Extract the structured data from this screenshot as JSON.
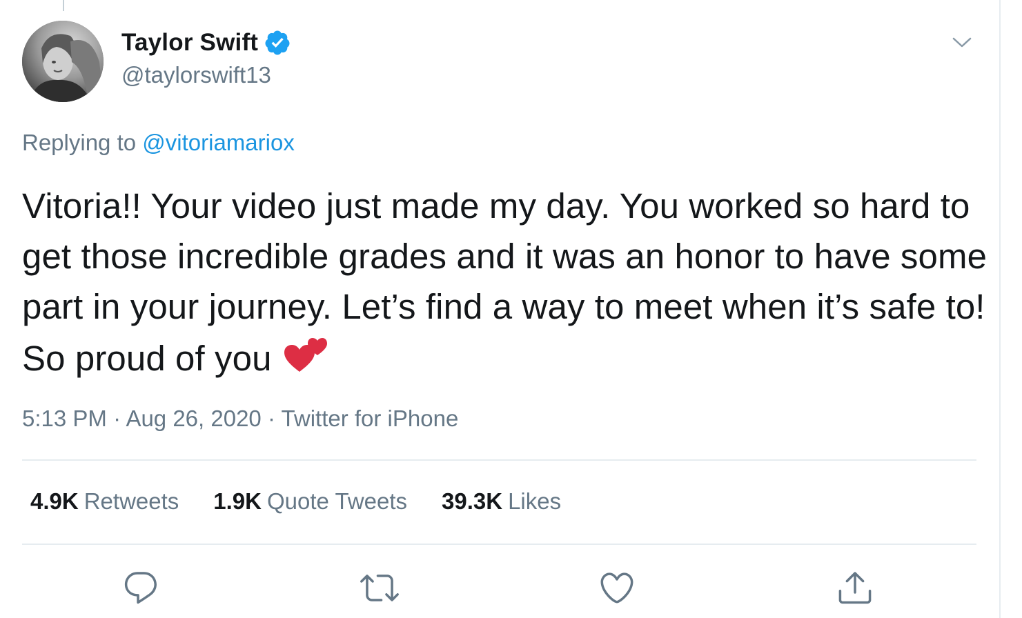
{
  "author": {
    "display_name": "Taylor Swift",
    "handle": "@taylorswift13",
    "verified": true,
    "avatar_icon": "profile-photo"
  },
  "reply": {
    "prefix": "Replying to",
    "mention": "@vitoriamariox"
  },
  "tweet": {
    "text": "Vitoria!! Your video just made my day. You worked so hard to get those incredible grades and it was an honor to have some part in your journey. Let’s find a way to meet when it’s safe to! So proud of you",
    "emoji_icon": "two-hearts-icon"
  },
  "meta": {
    "time": "5:13 PM",
    "date": "Aug 26, 2020",
    "separator": "·",
    "source": "Twitter for iPhone"
  },
  "stats": {
    "retweets_count": "4.9K",
    "retweets_label": "Retweets",
    "quotes_count": "1.9K",
    "quotes_label": "Quote Tweets",
    "likes_count": "39.3K",
    "likes_label": "Likes"
  },
  "actions": [
    "reply-icon",
    "retweet-icon",
    "like-icon",
    "share-icon"
  ],
  "colors": {
    "text": "#14171a",
    "secondary": "#657786",
    "link": "#1b95e0",
    "verified": "#1da1f2",
    "heart": "#e0245e",
    "divider": "#e6ecf0"
  }
}
